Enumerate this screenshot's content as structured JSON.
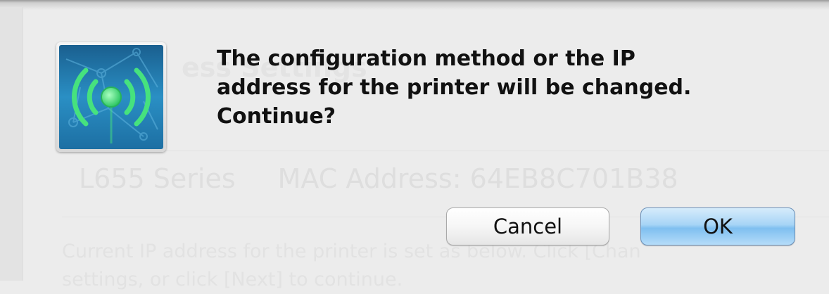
{
  "background_window": {
    "title": "ess Settings",
    "printer_model": "L655 Series",
    "mac_address_text": "MAC Address: 64EB8C701B38",
    "description_line1": "Current IP address for the printer is set as below. Click [Chan",
    "description_line2": "settings, or click [Next] to continue."
  },
  "dialog": {
    "icon": "wireless-signal-app-icon",
    "message_line1": "The configuration method or the IP",
    "message_line2": "address for the printer will be changed.",
    "message_line3": "Continue?",
    "cancel_label": "Cancel",
    "ok_label": "OK"
  },
  "colors": {
    "dialog_background": "#ececec",
    "icon_blue": "#1f7fb3",
    "icon_signal_green": "#3fe07a",
    "default_button_blue": "#8cc6f2"
  }
}
